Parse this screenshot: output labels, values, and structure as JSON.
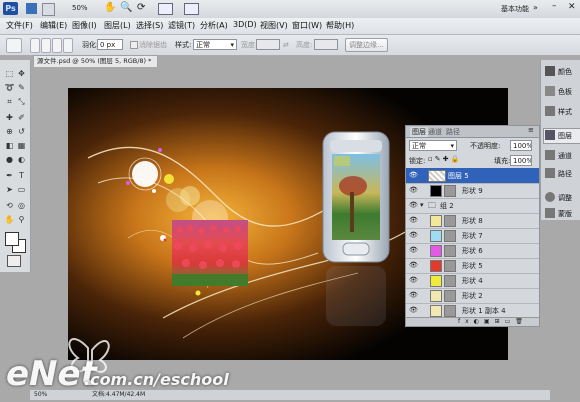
{
  "app": {
    "logo": "Ps",
    "zoom": "50%",
    "workspace": "基本功能"
  },
  "menu": [
    "文件(F)",
    "编辑(E)",
    "图像(I)",
    "图层(L)",
    "选择(S)",
    "滤镜(T)",
    "分析(A)",
    "3D(D)",
    "视图(V)",
    "窗口(W)",
    "帮助(H)"
  ],
  "options": {
    "feather_label": "羽化:",
    "feather_value": "0 px",
    "antialias": "消除锯齿",
    "style_label": "样式:",
    "style_value": "正常",
    "width_label": "宽度:",
    "height_label": "高度:",
    "refine_edge": "调整边缘..."
  },
  "document": {
    "tab": "源文件.psd @ 50% (图层 5, RGB/8) *",
    "zoom_status": "50%",
    "doc_info": "文档:4.47M/42.4M"
  },
  "dock": [
    "颜色",
    "色板",
    "样式",
    "图层",
    "通道",
    "路径",
    "调整",
    "蒙版"
  ],
  "layers_panel": {
    "tabs": [
      "图层",
      "通道",
      "路径"
    ],
    "blend_mode": "正常",
    "opacity_label": "不透明度:",
    "opacity": "100%",
    "lock_label": "锁定:",
    "fill_label": "填充:",
    "fill": "100%",
    "layers": [
      {
        "name": "图层 5",
        "selected": true,
        "color": ""
      },
      {
        "name": "形状 9",
        "selected": false,
        "color": "#000000"
      },
      {
        "name": "组 2",
        "selected": false,
        "color": "",
        "group": true
      },
      {
        "name": "形状 8",
        "selected": false,
        "color": "#f3e79a"
      },
      {
        "name": "形状 7",
        "selected": false,
        "color": "#9fdcf2"
      },
      {
        "name": "形状 6",
        "selected": false,
        "color": "#e45ae4"
      },
      {
        "name": "形状 5",
        "selected": false,
        "color": "#e43a2c"
      },
      {
        "name": "形状 4",
        "selected": false,
        "color": "#f0ea3a"
      },
      {
        "name": "形状 2",
        "selected": false,
        "color": "#f1e7b0"
      },
      {
        "name": "形状 1 副本 4",
        "selected": false,
        "color": "#f1e7b0"
      }
    ]
  },
  "watermark": {
    "brand": "eNet",
    "url": ".com.cn/eschool"
  },
  "colors": {
    "selected_layer": "#2f62b8",
    "canvas_bg": "#050302",
    "glow": "#d98a1a"
  }
}
